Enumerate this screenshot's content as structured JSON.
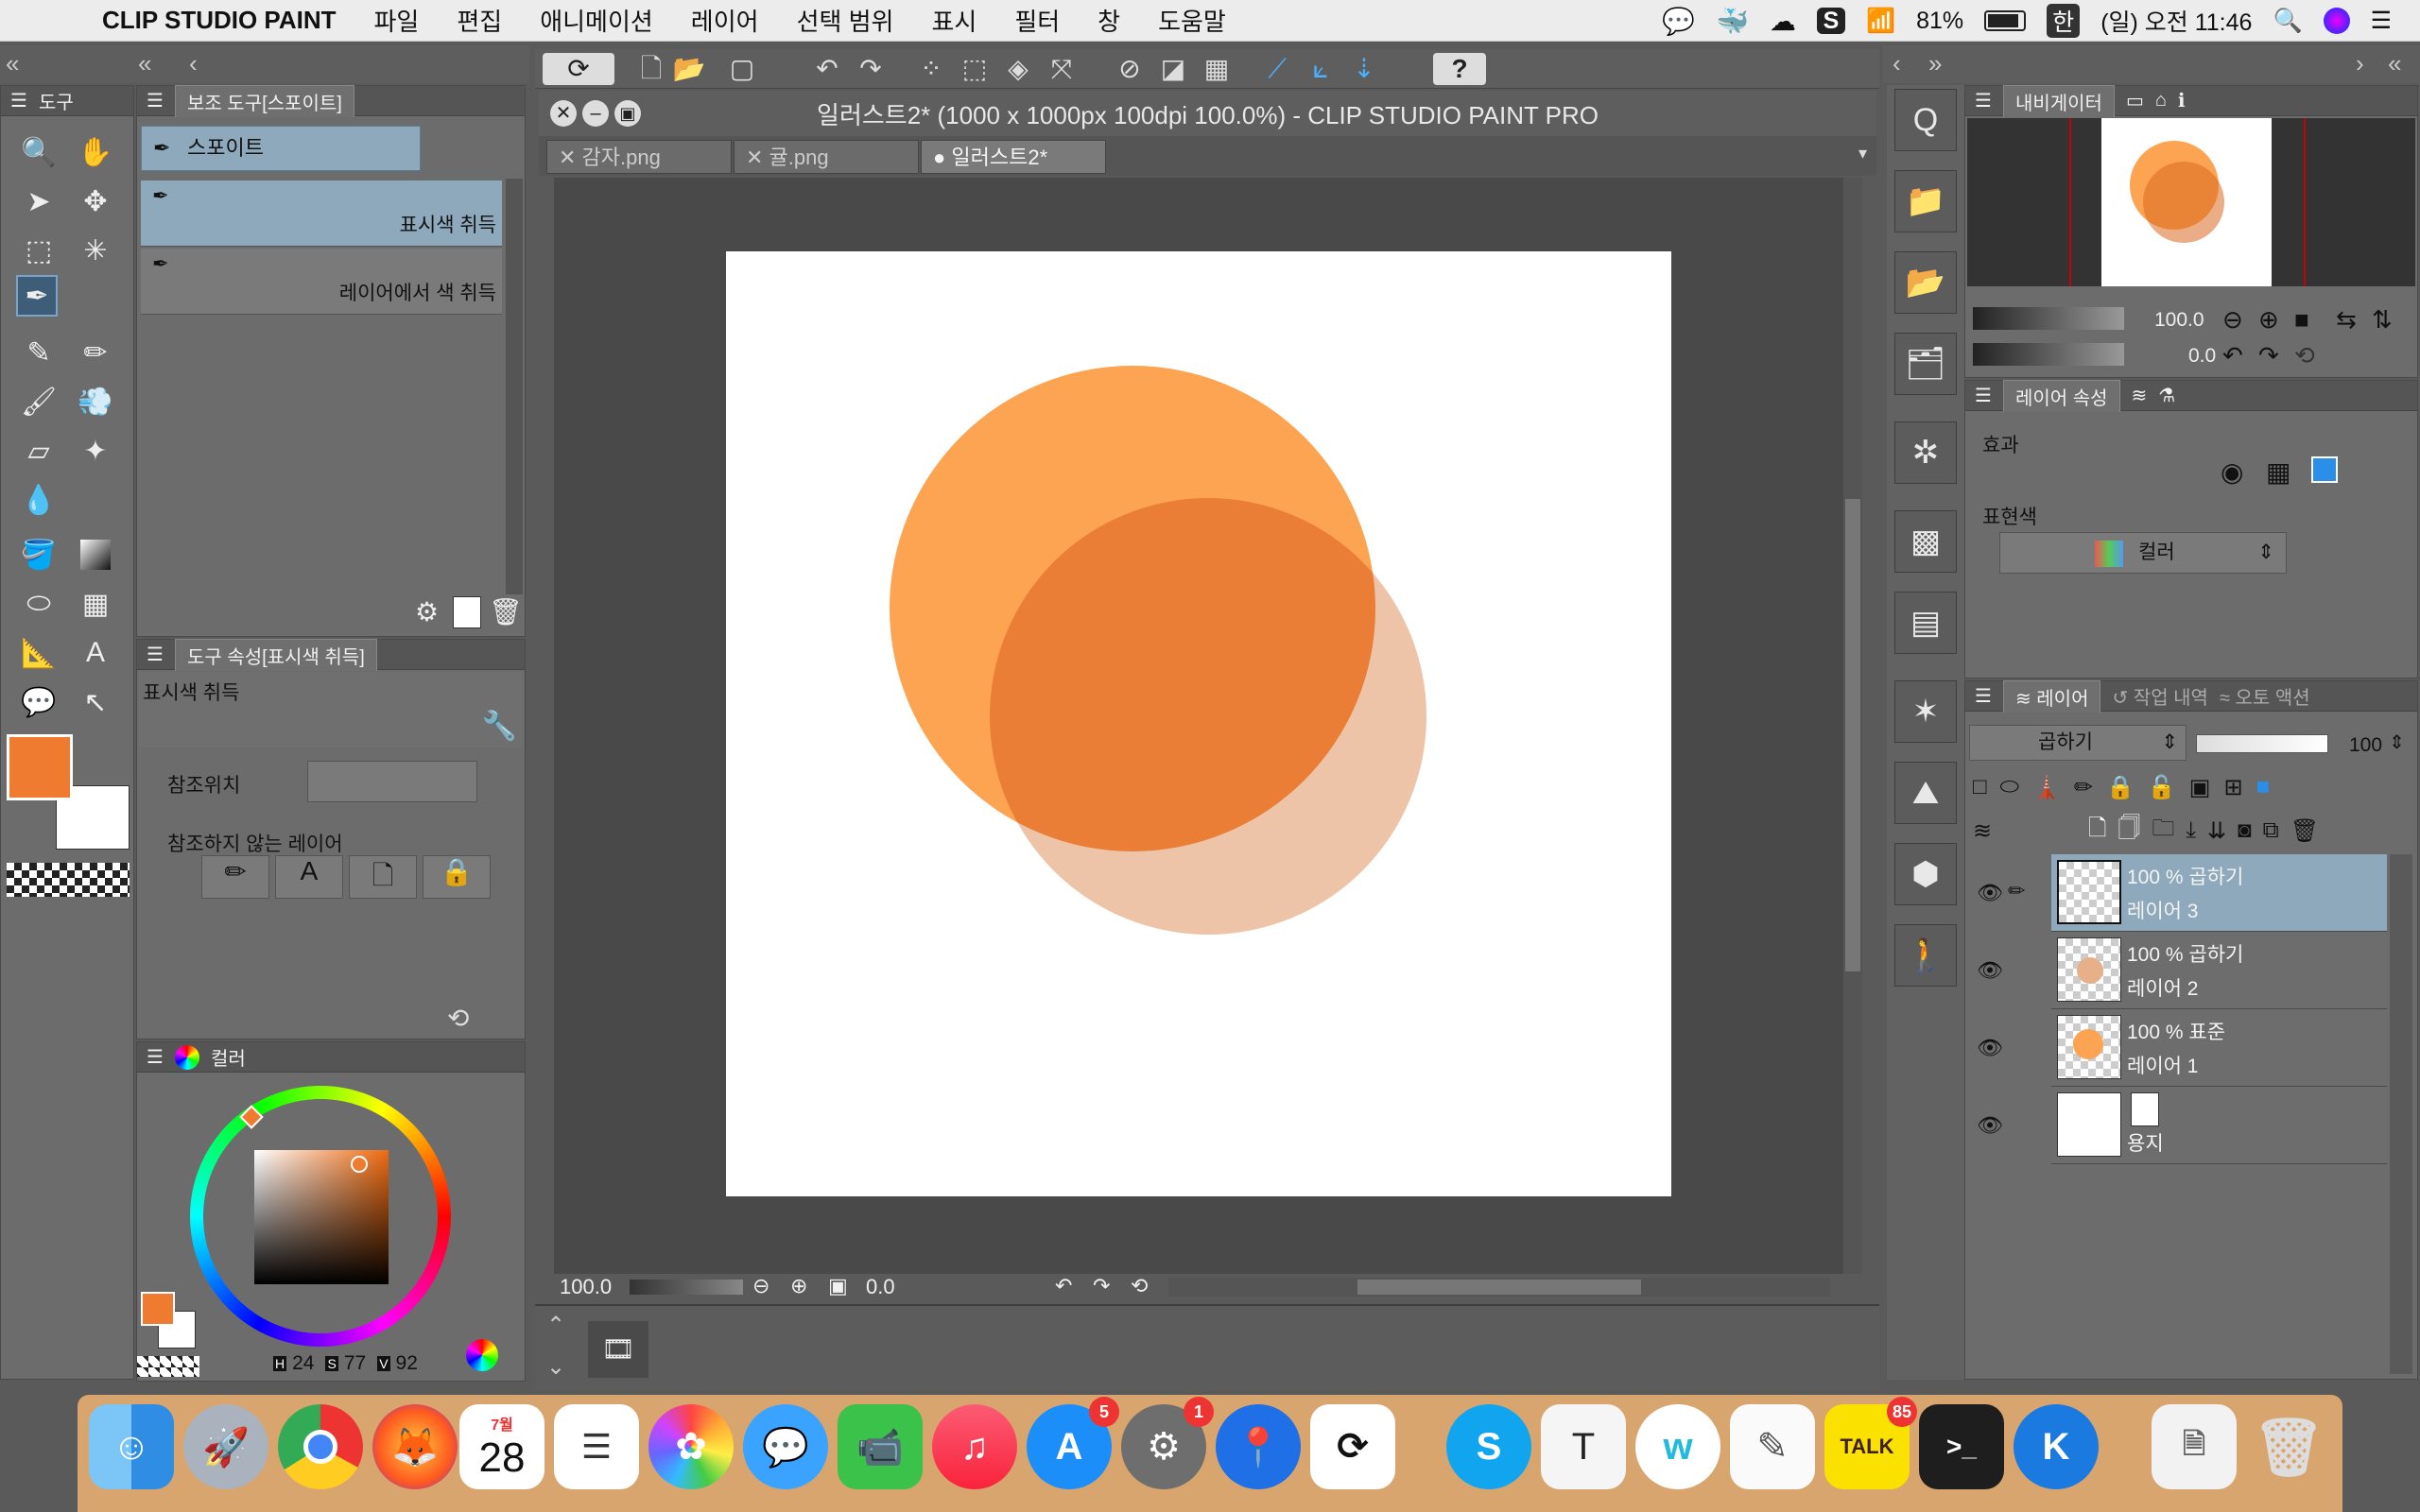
{
  "menubar": {
    "app_name": "CLIP STUDIO PAINT",
    "items": [
      "파일",
      "편집",
      "애니메이션",
      "레이어",
      "선택 범위",
      "표시",
      "필터",
      "창",
      "도움말"
    ],
    "battery": "81%",
    "input_lang": "한",
    "clock": "(일) 오전 11:46"
  },
  "tool_panel": {
    "tab": "도구"
  },
  "subtool_panel": {
    "tab": "보조 도구[스포이트]",
    "group_label": "스포이트",
    "items": [
      "표시색 취득",
      "레이어에서 색 취득"
    ]
  },
  "tool_property": {
    "tab": "도구 속성[표시색 취득]",
    "title": "표시색 취득",
    "ref_label": "참조위치",
    "exclude_label": "참조하지 않는 레이어"
  },
  "color_panel": {
    "tab": "컬러",
    "h_label": "H",
    "h": "24",
    "s_label": "S",
    "s": "77",
    "v_label": "V",
    "v": "92",
    "main_color": "#ee7b30",
    "sub_color": "#ffffff"
  },
  "document": {
    "title": "일러스트2* (1000 x 1000px 100dpi 100.0%)  - CLIP STUDIO PAINT PRO",
    "tabs": [
      "감자.png",
      "귤.png",
      "일러스트2*"
    ],
    "zoom": "100.0",
    "rotation": "0.0"
  },
  "navigator": {
    "tab": "내비게이터",
    "zoom": "100.0",
    "rotation": "0.0"
  },
  "layer_property": {
    "tab": "레이어 속성",
    "effect_label": "효과",
    "expression_label": "표현색",
    "expression_value": "컬러"
  },
  "layer_panel": {
    "tabs": [
      "레이어",
      "작업 내역",
      "오토 액션"
    ],
    "blend_mode": "곱하기",
    "opacity": "100",
    "layers": [
      {
        "mode": "100 % 곱하기",
        "name": "레이어 3"
      },
      {
        "mode": "100 % 곱하기",
        "name": "레이어 2"
      },
      {
        "mode": "100 % 표준",
        "name": "레이어 1"
      },
      {
        "mode": "",
        "name": "용지"
      }
    ]
  },
  "dock": {
    "calendar_month": "7월",
    "calendar_day": "28",
    "appstore_badge": "5",
    "settings_badge": "1",
    "kakaotalk_badge": "85",
    "kakaotalk_label": "TALK"
  }
}
